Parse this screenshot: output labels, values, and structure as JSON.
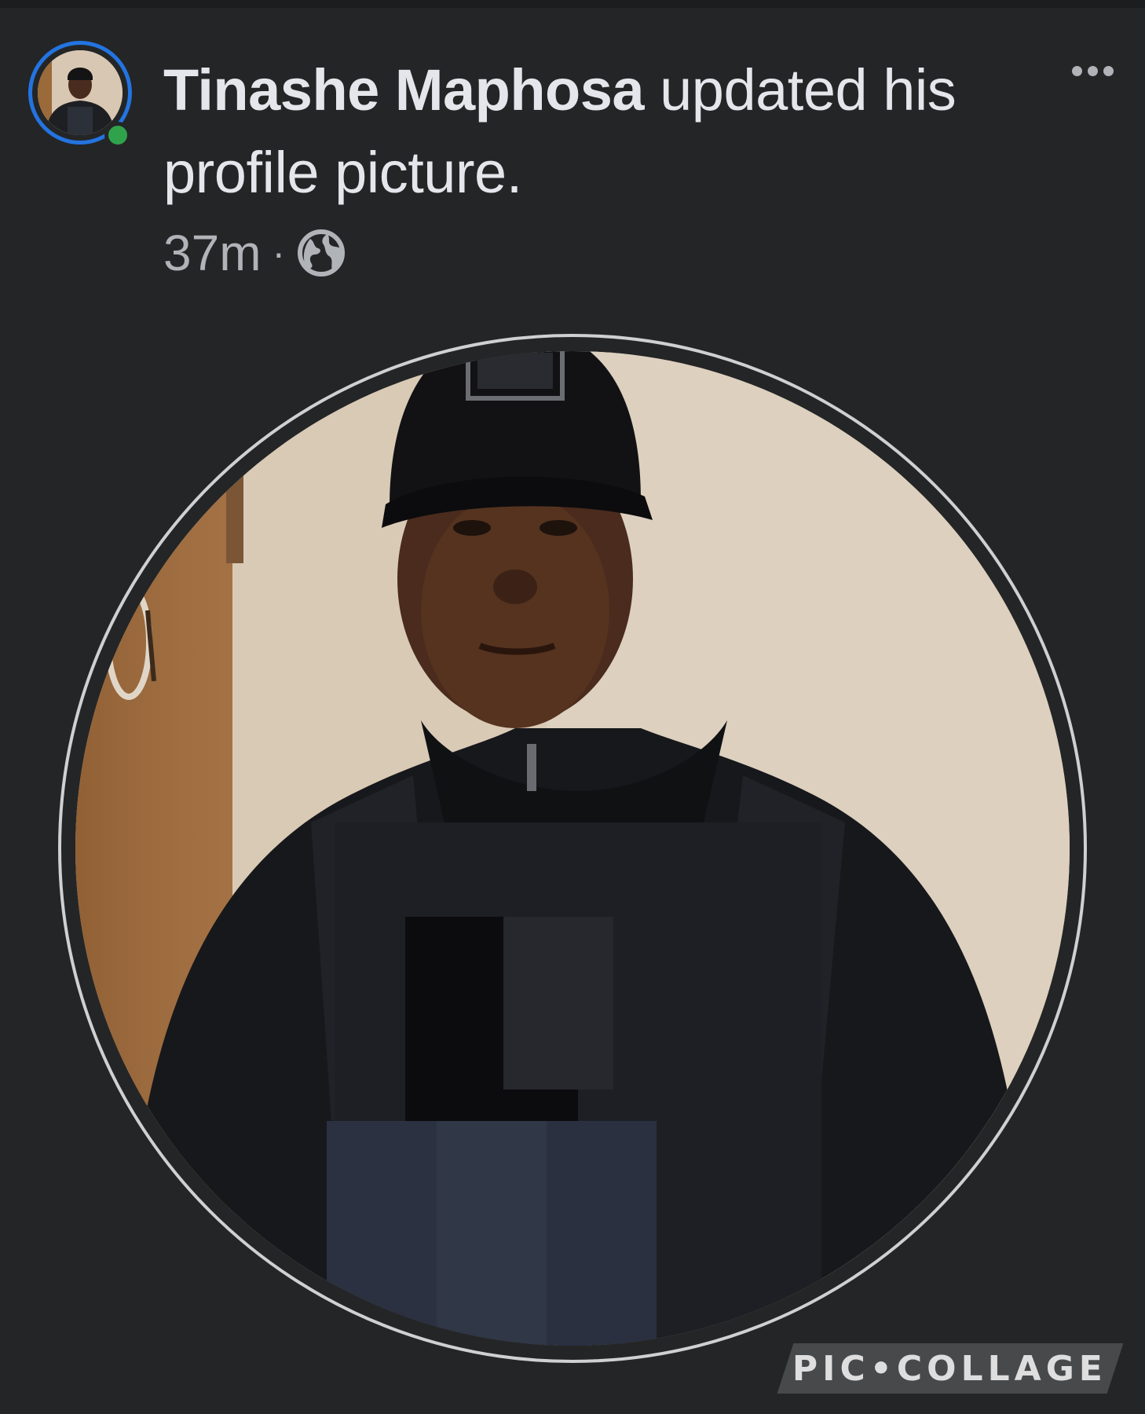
{
  "post": {
    "author_name": "Tinashe Maphosa",
    "action_text": " updated his profile picture.",
    "timestamp": "37m",
    "separator": "·",
    "audience_icon": "globe-icon",
    "more_icon": "more-options-icon"
  },
  "status": {
    "online": true,
    "online_color": "#31a24c",
    "story_ring_color": "#2374e1"
  },
  "watermark": {
    "text": "PIC•COLLAGE"
  },
  "colors": {
    "background": "#242526",
    "primary_text": "#e4e6eb",
    "secondary_text": "#b0b3b8"
  }
}
